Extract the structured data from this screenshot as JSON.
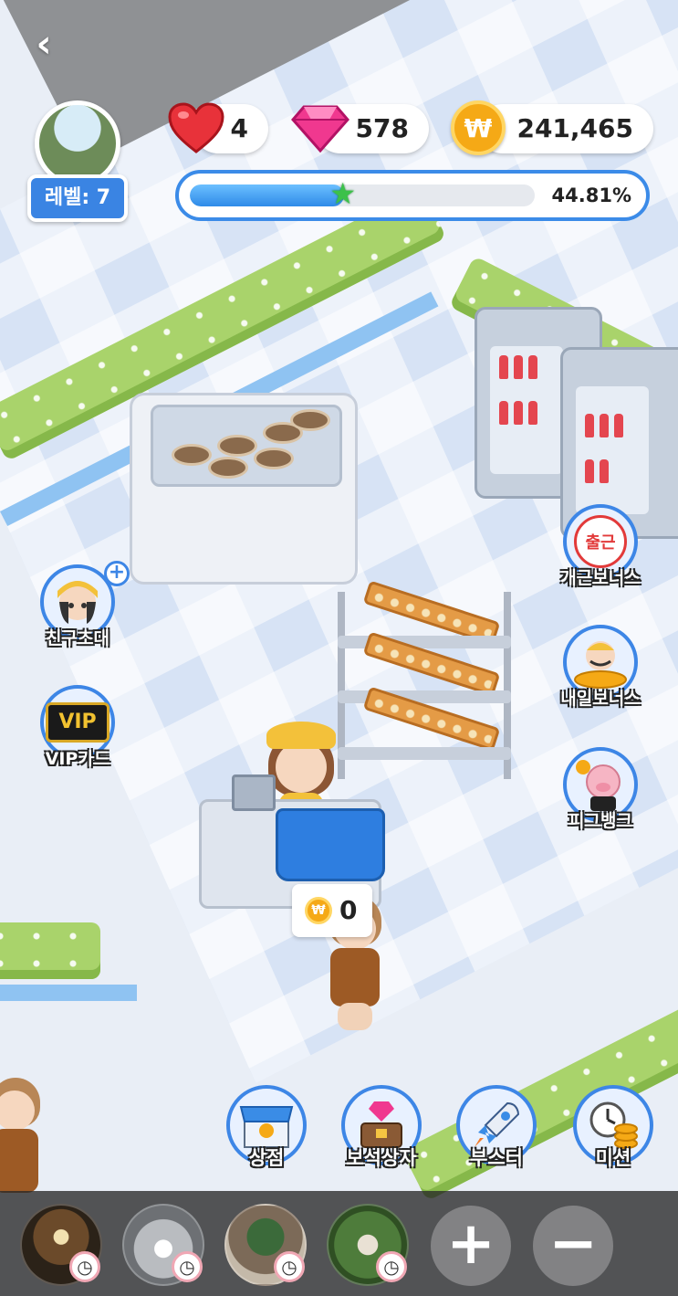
{
  "hud": {
    "back_icon": "chevron-left-icon",
    "level_label": "레벨: 7",
    "hearts": "4",
    "gems": "578",
    "coins": "241,465",
    "coin_symbol": "₩",
    "progress_percent_text": "44.81%",
    "progress_value": 0.4481
  },
  "side_left": [
    {
      "label": "친구초대",
      "icon": "invite-friend-icon"
    },
    {
      "label": "VIP카드",
      "icon": "vip-card-icon",
      "badge_text": "VIP"
    }
  ],
  "side_right": [
    {
      "label": "개근보너스",
      "icon": "attendance-stamp-icon",
      "stamp_text": "출근"
    },
    {
      "label": "내일보너스",
      "icon": "tomorrow-bonus-icon"
    },
    {
      "label": "피그뱅크",
      "icon": "piggy-bank-icon"
    }
  ],
  "register_coins": {
    "symbol": "₩",
    "amount": "0"
  },
  "actions": [
    {
      "label": "상점",
      "icon": "shop-icon"
    },
    {
      "label": "보석상자",
      "icon": "gem-chest-icon"
    },
    {
      "label": "부스터",
      "icon": "rocket-booster-icon"
    },
    {
      "label": "미션",
      "icon": "mission-clock-icon"
    }
  ],
  "photo_bar": {
    "slots": [
      {
        "icon": "photo-thumbnail-icon",
        "timer_icon": "clock-icon"
      },
      {
        "icon": "photo-thumbnail-icon",
        "timer_icon": "clock-icon"
      },
      {
        "icon": "photo-thumbnail-icon",
        "timer_icon": "clock-icon"
      },
      {
        "icon": "photo-thumbnail-icon",
        "timer_icon": "clock-icon"
      }
    ],
    "zoom_in": "+",
    "zoom_out": "−"
  },
  "colors": {
    "accent_blue": "#3d86e6",
    "coin_gold": "#f5a916",
    "heart_red": "#e8323a",
    "gem_pink": "#f0388f",
    "star_green": "#3cc14a"
  }
}
